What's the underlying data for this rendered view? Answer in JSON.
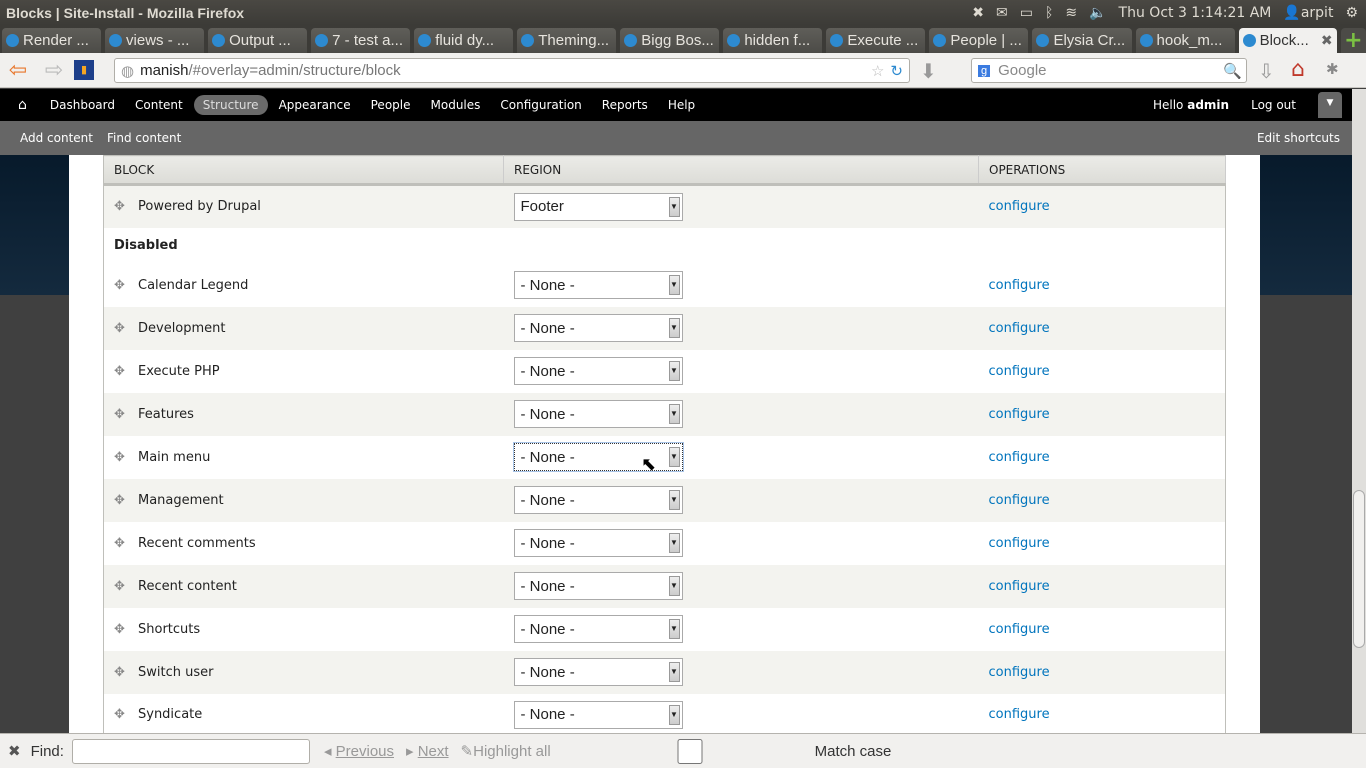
{
  "window": {
    "title": "Blocks | Site-Install - Mozilla Firefox"
  },
  "tray": {
    "datetime": "Thu Oct  3  1:14:21 AM",
    "user": "arpit"
  },
  "tabs": [
    {
      "label": "Render ..."
    },
    {
      "label": "views - ..."
    },
    {
      "label": "Output ..."
    },
    {
      "label": "7 - test a..."
    },
    {
      "label": "fluid dy..."
    },
    {
      "label": "Theming..."
    },
    {
      "label": "Bigg Bos..."
    },
    {
      "label": "hidden f..."
    },
    {
      "label": "Execute ..."
    },
    {
      "label": "People | ..."
    },
    {
      "label": "Elysia Cr..."
    },
    {
      "label": "hook_m..."
    },
    {
      "label": "Block...",
      "active": true
    }
  ],
  "address": {
    "host": "manish",
    "path": "/#overlay=admin/structure/block"
  },
  "search": {
    "placeholder": "Google"
  },
  "admin_toolbar": {
    "items": [
      "Dashboard",
      "Content",
      "Structure",
      "Appearance",
      "People",
      "Modules",
      "Configuration",
      "Reports",
      "Help"
    ],
    "active": "Structure",
    "hello": "Hello",
    "username": "admin",
    "logout": "Log out"
  },
  "shortcuts": {
    "items": [
      "Add content",
      "Find content"
    ],
    "edit": "Edit shortcuts"
  },
  "table": {
    "headers": {
      "block": "BLOCK",
      "region": "REGION",
      "operations": "OPERATIONS"
    },
    "enabled_rows": [
      {
        "block": "Powered by Drupal",
        "region": "Footer",
        "op": "configure"
      }
    ],
    "disabled_label": "Disabled",
    "disabled_rows": [
      {
        "block": "Calendar Legend",
        "region": "- None -",
        "op": "configure"
      },
      {
        "block": "Development",
        "region": "- None -",
        "op": "configure"
      },
      {
        "block": "Execute PHP",
        "region": "- None -",
        "op": "configure"
      },
      {
        "block": "Features",
        "region": "- None -",
        "op": "configure"
      },
      {
        "block": "Main menu",
        "region": "- None -",
        "op": "configure"
      },
      {
        "block": "Management",
        "region": "- None -",
        "op": "configure"
      },
      {
        "block": "Recent comments",
        "region": "- None -",
        "op": "configure"
      },
      {
        "block": "Recent content",
        "region": "- None -",
        "op": "configure"
      },
      {
        "block": "Shortcuts",
        "region": "- None -",
        "op": "configure"
      },
      {
        "block": "Switch user",
        "region": "- None -",
        "op": "configure"
      },
      {
        "block": "Syndicate",
        "region": "- None -",
        "op": "configure"
      }
    ]
  },
  "findbar": {
    "label": "Find:",
    "previous": "Previous",
    "next": "Next",
    "highlight": "Highlight all",
    "match_case": "Match case"
  }
}
